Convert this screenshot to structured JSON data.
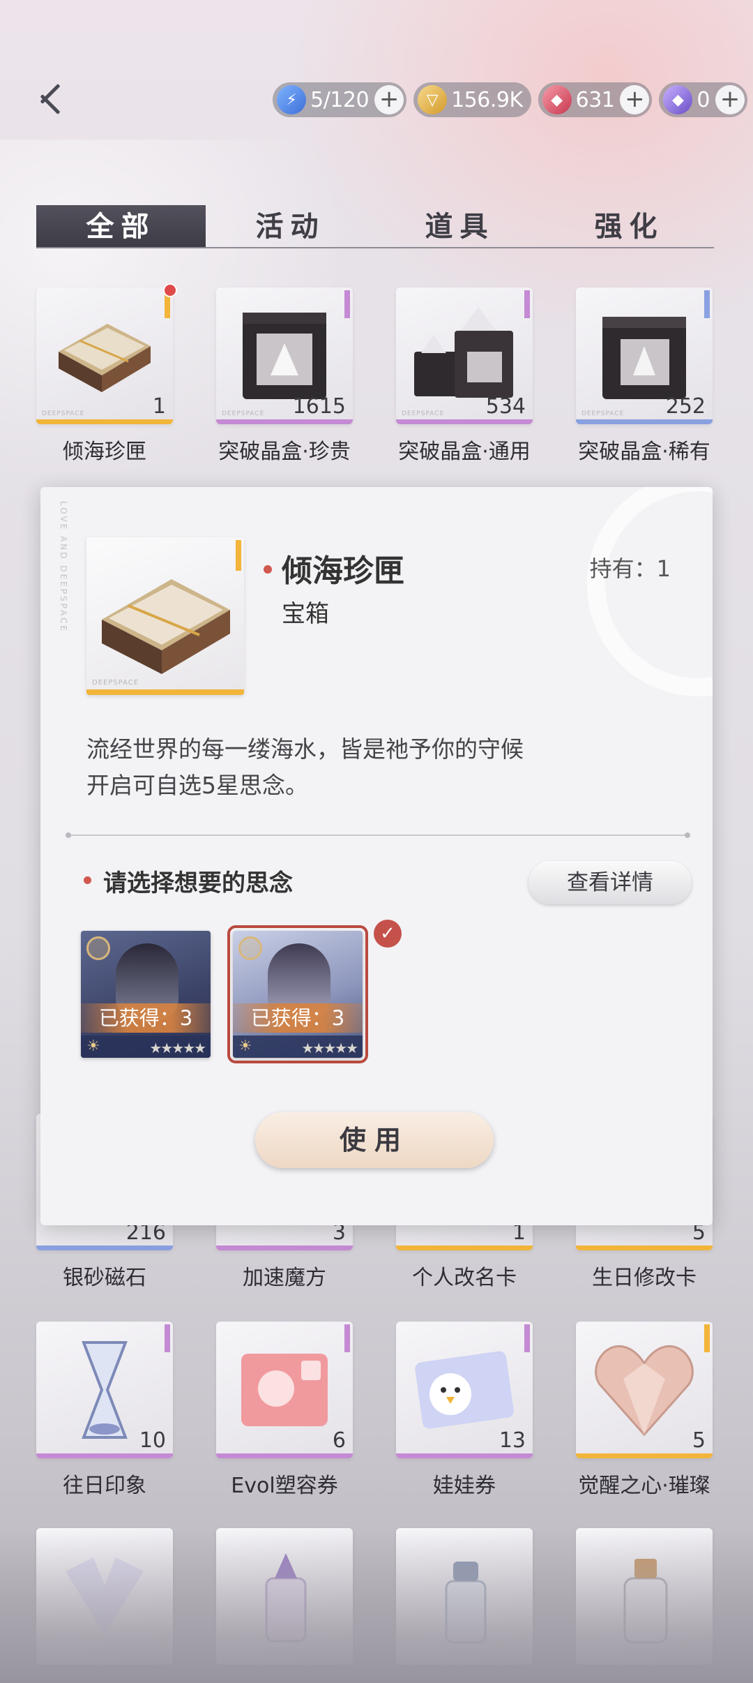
{
  "currencies": [
    {
      "icon": "stamina-lightning-icon",
      "value": "5/120"
    },
    {
      "icon": "gold-coin-icon",
      "value": "156.9K"
    },
    {
      "icon": "red-crystal-icon",
      "value": "631"
    },
    {
      "icon": "purple-diamond-icon",
      "value": "0"
    }
  ],
  "plus_label": "+",
  "tabs": [
    "全部",
    "活动",
    "道具",
    "强化"
  ],
  "grid_row1": [
    {
      "name": "倾海珍匣",
      "count": "1",
      "rarity_color": "#f2b53a",
      "red_dot": true
    },
    {
      "name": "突破晶盒·珍贵",
      "count": "1615",
      "rarity_color": "#c58ad4"
    },
    {
      "name": "突破晶盒·通用",
      "count": "534",
      "rarity_color": "#c58ad4"
    },
    {
      "name": "突破晶盒·稀有",
      "count": "252",
      "rarity_color": "#8aa0e0"
    }
  ],
  "grid_row2": [
    {
      "name": "银砂磁石",
      "count": "216",
      "rarity_color": "#8aa0e0"
    },
    {
      "name": "加速魔方",
      "count": "3",
      "rarity_color": "#c58ad4"
    },
    {
      "name": "个人改名卡",
      "count": "1",
      "rarity_color": "#f2b53a"
    },
    {
      "name": "生日修改卡",
      "count": "5",
      "rarity_color": "#f2b53a"
    }
  ],
  "grid_row3": [
    {
      "name": "往日印象",
      "count": "10",
      "rarity_color": "#c58ad4"
    },
    {
      "name": "Evol塑容券",
      "count": "6",
      "rarity_color": "#c58ad4"
    },
    {
      "name": "娃娃券",
      "count": "13",
      "rarity_color": "#c58ad4"
    },
    {
      "name": "觉醒之心·璀璨",
      "count": "5",
      "rarity_color": "#f2b53a"
    }
  ],
  "brand_text": "DEEPSPACE",
  "popup": {
    "title": "倾海珍匣",
    "type": "宝箱",
    "hold_label": "持有：1",
    "description_line1": "流经世界的每一缕海水，皆是祂予你的守候",
    "description_line2": "开启可自选5星思念。",
    "select_title": "请选择想要的思念",
    "detail_button": "查看详情",
    "memories": [
      {
        "obtained": "已获得：3",
        "stars": "★★★★★",
        "selected": false
      },
      {
        "obtained": "已获得：3",
        "stars": "★★★★★",
        "selected": true
      }
    ],
    "use_button": "使用",
    "side_text": "LOVE AND DEEPSPACE"
  },
  "colors": {
    "accent_red": "#d0584f",
    "gold_rarity": "#f2b53a",
    "purple_rarity": "#c58ad4",
    "blue_rarity": "#8aa0e0"
  }
}
